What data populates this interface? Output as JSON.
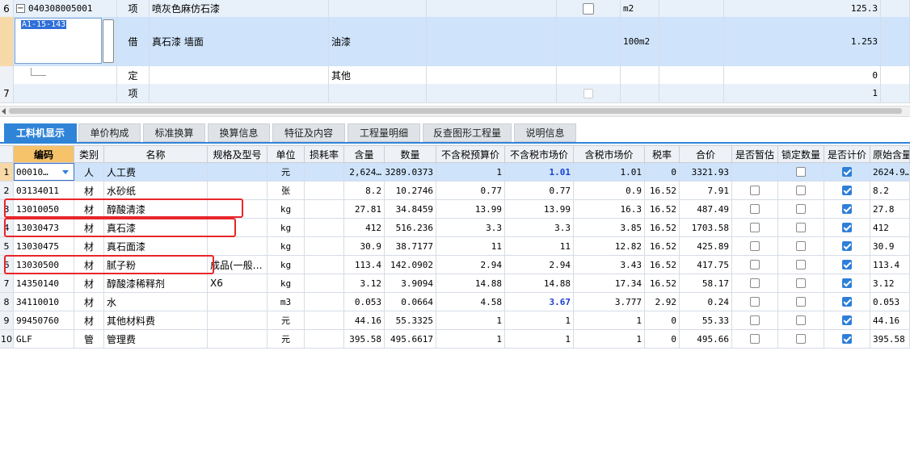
{
  "upper": {
    "rows": [
      {
        "num": "6",
        "code": "040308005001",
        "type": "项",
        "name": "喷灰色麻仿石漆",
        "spec": "",
        "unit": "m2",
        "qty": "125.3",
        "checkbox": true
      },
      {
        "num": "",
        "code": "A1-15-143",
        "type": "借",
        "name": "真石漆 墙面",
        "spec": "油漆",
        "unit": "100m2",
        "qty": "1.253",
        "checkbox": false
      },
      {
        "num": "",
        "code": "",
        "type": "定",
        "name": "",
        "spec": "其他",
        "unit": "",
        "qty": "0",
        "checkbox": false
      },
      {
        "num": "7",
        "code": "",
        "type": "项",
        "name": "",
        "spec": "",
        "unit": "",
        "qty": "1",
        "checkbox": true
      }
    ],
    "ellipsis": "⋯"
  },
  "tabs": [
    "工料机显示",
    "单价构成",
    "标准换算",
    "换算信息",
    "特征及内容",
    "工程量明细",
    "反查图形工程量",
    "说明信息"
  ],
  "columns": [
    "编码",
    "类别",
    "名称",
    "规格及型号",
    "单位",
    "损耗率",
    "含量",
    "数量",
    "不含税预算价",
    "不含税市场价",
    "含税市场价",
    "税率",
    "合价",
    "是否暂估",
    "锁定数量",
    "是否计价",
    "原始含量"
  ],
  "rows": [
    {
      "n": "1",
      "code": "00010…",
      "cat": "人",
      "name": "人工费",
      "spec": "",
      "unit": "元",
      "loss": "",
      "content": "2,624…",
      "qty": "3289.0373",
      "budget": "1",
      "market": "1.01",
      "market_tax": "1.01",
      "rate": "0",
      "total": "3321.93",
      "est": false,
      "lock": false,
      "price": true,
      "orig": "2624.9…"
    },
    {
      "n": "2",
      "code": "03134011",
      "cat": "材",
      "name": "水砂纸",
      "spec": "",
      "unit": "张",
      "loss": "",
      "content": "8.2",
      "qty": "10.2746",
      "budget": "0.77",
      "market": "0.77",
      "market_tax": "0.9",
      "rate": "16.52",
      "total": "7.91",
      "est": false,
      "lock": false,
      "price": true,
      "orig": "8.2"
    },
    {
      "n": "3",
      "code": "13010050",
      "cat": "材",
      "name": "醇酸清漆",
      "spec": "",
      "unit": "kg",
      "loss": "",
      "content": "27.81",
      "qty": "34.8459",
      "budget": "13.99",
      "market": "13.99",
      "market_tax": "16.3",
      "rate": "16.52",
      "total": "487.49",
      "est": false,
      "lock": false,
      "price": true,
      "orig": "27.8"
    },
    {
      "n": "4",
      "code": "13030473",
      "cat": "材",
      "name": "真石漆",
      "spec": "",
      "unit": "kg",
      "loss": "",
      "content": "412",
      "qty": "516.236",
      "budget": "3.3",
      "market": "3.3",
      "market_tax": "3.85",
      "rate": "16.52",
      "total": "1703.58",
      "est": false,
      "lock": false,
      "price": true,
      "orig": "412"
    },
    {
      "n": "5",
      "code": "13030475",
      "cat": "材",
      "name": "真石面漆",
      "spec": "",
      "unit": "kg",
      "loss": "",
      "content": "30.9",
      "qty": "38.7177",
      "budget": "11",
      "market": "11",
      "market_tax": "12.82",
      "rate": "16.52",
      "total": "425.89",
      "est": false,
      "lock": false,
      "price": true,
      "orig": "30.9"
    },
    {
      "n": "6",
      "code": "13030500",
      "cat": "材",
      "name": "腻子粉",
      "spec": "成品(一般…",
      "unit": "kg",
      "loss": "",
      "content": "113.4",
      "qty": "142.0902",
      "budget": "2.94",
      "market": "2.94",
      "market_tax": "3.43",
      "rate": "16.52",
      "total": "417.75",
      "est": false,
      "lock": false,
      "price": true,
      "orig": "113.4"
    },
    {
      "n": "7",
      "code": "14350140",
      "cat": "材",
      "name": "醇酸漆稀释剂",
      "spec": "X6",
      "unit": "kg",
      "loss": "",
      "content": "3.12",
      "qty": "3.9094",
      "budget": "14.88",
      "market": "14.88",
      "market_tax": "17.34",
      "rate": "16.52",
      "total": "58.17",
      "est": false,
      "lock": false,
      "price": true,
      "orig": "3.12"
    },
    {
      "n": "8",
      "code": "34110010",
      "cat": "材",
      "name": "水",
      "spec": "",
      "unit": "m3",
      "loss": "",
      "content": "0.053",
      "qty": "0.0664",
      "budget": "4.58",
      "market": "3.67",
      "market_tax": "3.777",
      "rate": "2.92",
      "total": "0.24",
      "est": false,
      "lock": false,
      "price": true,
      "orig": "0.053"
    },
    {
      "n": "9",
      "code": "99450760",
      "cat": "材",
      "name": "其他材料费",
      "spec": "",
      "unit": "元",
      "loss": "",
      "content": "44.16",
      "qty": "55.3325",
      "budget": "1",
      "market": "1",
      "market_tax": "1",
      "rate": "0",
      "total": "55.33",
      "est": false,
      "lock": false,
      "price": true,
      "orig": "44.16"
    },
    {
      "n": "10",
      "code": "GLF",
      "cat": "管",
      "name": "管理费",
      "spec": "",
      "unit": "元",
      "loss": "",
      "content": "395.58",
      "qty": "495.6617",
      "budget": "1",
      "market": "1",
      "market_tax": "1",
      "rate": "0",
      "total": "495.66",
      "est": false,
      "lock": false,
      "price": true,
      "orig": "395.58"
    }
  ],
  "colors": {
    "accent": "#2f84d8",
    "highlight": "#e8262b",
    "selected_row": "#cfe4fb",
    "blue_text": "#1a3fcf"
  }
}
